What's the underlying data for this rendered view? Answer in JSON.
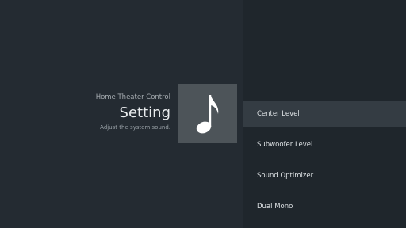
{
  "header": {
    "breadcrumb": "Home Theater Control",
    "title": "Setting",
    "description": "Adjust the system sound."
  },
  "icon": {
    "name": "music-note-icon"
  },
  "menu": {
    "items": [
      {
        "label": "Center Level",
        "selected": true
      },
      {
        "label": "Subwoofer Level",
        "selected": false
      },
      {
        "label": "Sound Optimizer",
        "selected": false
      },
      {
        "label": "Dual Mono",
        "selected": false
      }
    ]
  },
  "colors": {
    "background": "#242b32",
    "menu_background": "#1f262c",
    "selected_item": "#343c43",
    "icon_tile": "#4d5459"
  }
}
